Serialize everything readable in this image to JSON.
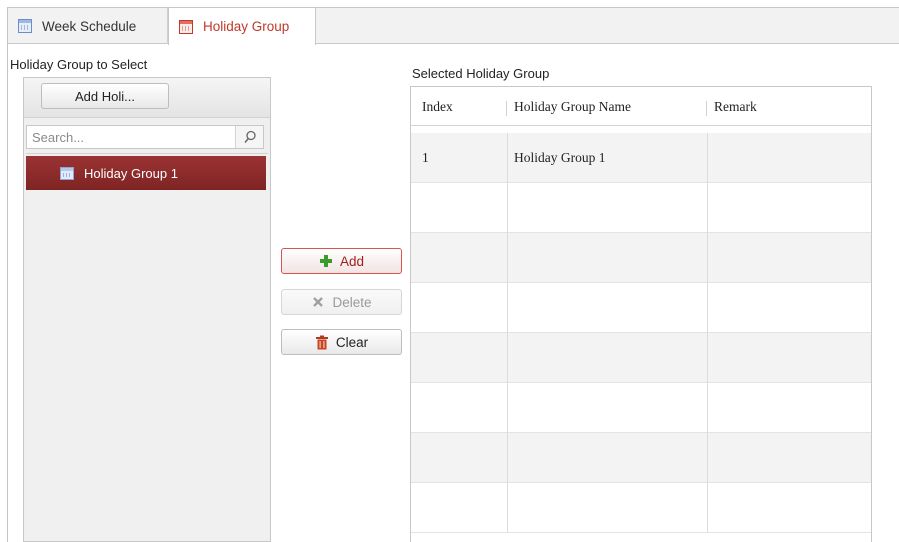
{
  "tabs": [
    {
      "label": "Week Schedule",
      "icon": "calendar-icon",
      "active": false
    },
    {
      "label": "Holiday Group",
      "icon": "calendar-red-icon",
      "active": true
    }
  ],
  "left": {
    "title": "Holiday Group to Select",
    "add_button": "Add Holi...",
    "search_placeholder": "Search...",
    "search_icon": "magnifier-icon",
    "items": [
      {
        "label": "Holiday Group 1",
        "icon": "calendar-icon",
        "selected": true
      }
    ]
  },
  "actions": {
    "add": "Add",
    "delete": "Delete",
    "clear": "Clear"
  },
  "right": {
    "title": "Selected Holiday Group",
    "columns": [
      "Index",
      "Holiday Group Name",
      "Remark"
    ],
    "rows": [
      {
        "index": "1",
        "name": "Holiday Group 1",
        "remark": ""
      }
    ]
  },
  "colors": {
    "accent": "#c0392b",
    "selected_row": "#8b2c2c",
    "add_green": "#3a9a2a"
  }
}
